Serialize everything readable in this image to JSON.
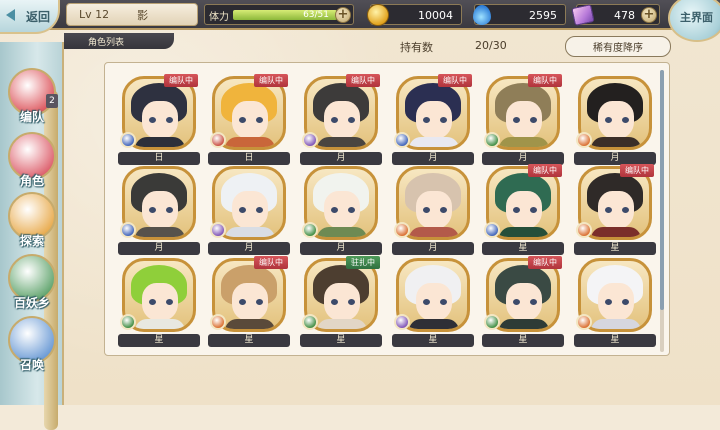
{
  "header": {
    "back_label": "返回",
    "level": "Lv 12",
    "player_name": "影",
    "stamina_label": "体力",
    "stamina_value": "63/51",
    "stamina_fraction": 1.0,
    "coins": "10004",
    "water": "2595",
    "gems": "478",
    "main_label": "主界面"
  },
  "subheader": {
    "list_tab": "角色列表",
    "owned_label": "持有数",
    "owned_count": "20/30",
    "sort_label": "稀有度降序"
  },
  "sidebar": {
    "items": [
      {
        "label": "编队",
        "icon": "team-icon",
        "badge": "2",
        "color": "#d9434b"
      },
      {
        "label": "角色",
        "icon": "character-icon",
        "color": "#d94e5c"
      },
      {
        "label": "探索",
        "icon": "explore-icon",
        "color": "#e6a23b"
      },
      {
        "label": "百妖乡",
        "icon": "village-icon",
        "color": "#4f9a5d"
      },
      {
        "label": "召唤",
        "icon": "summon-icon",
        "color": "#5a8fd0"
      }
    ]
  },
  "characters": [
    {
      "name": "日",
      "tag": "编队中",
      "hair": "#2e3140",
      "body": "#2c2f3a",
      "elem": "#3a5fb8"
    },
    {
      "name": "日",
      "tag": "编队中",
      "hair": "#f0b43c",
      "body": "#c9663a",
      "elem": "#c84a3e"
    },
    {
      "name": "月",
      "tag": "编队中",
      "hair": "#3d3b3a",
      "body": "#4a4540",
      "elem": "#7b4fb5"
    },
    {
      "name": "月",
      "tag": "编队中",
      "hair": "#2b2f52",
      "body": "#e8e8f0",
      "elem": "#3a5fb8"
    },
    {
      "name": "月",
      "tag": "编队中",
      "hair": "#8f7e58",
      "body": "#a0944a",
      "elem": "#3a8a3e"
    },
    {
      "name": "月",
      "tag": "",
      "hair": "#23201f",
      "body": "#3b2e28",
      "elem": "#d96a2a"
    },
    {
      "name": "月",
      "tag": "",
      "hair": "#3a3a38",
      "body": "#56524c",
      "elem": "#3a5fb8"
    },
    {
      "name": "月",
      "tag": "",
      "hair": "#eef1f4",
      "body": "#d9dde4",
      "elem": "#7b4fb5"
    },
    {
      "name": "月",
      "tag": "",
      "hair": "#f1f3ee",
      "body": "#6e8a53",
      "elem": "#3a8a3e"
    },
    {
      "name": "月",
      "tag": "",
      "hair": "#d7c3ae",
      "body": "#b35a4a",
      "elem": "#d96a2a"
    },
    {
      "name": "星",
      "tag": "编队中",
      "hair": "#2f6b52",
      "body": "#264f3a",
      "elem": "#3a5fb8"
    },
    {
      "name": "星",
      "tag": "编队中",
      "hair": "#2f2a28",
      "body": "#7a2e2a",
      "elem": "#d96a2a"
    },
    {
      "name": "星",
      "tag": "",
      "hair": "#8fcf3a",
      "body": "#e8e8e0",
      "elem": "#3a8a3e"
    },
    {
      "name": "星",
      "tag": "编队中",
      "hair": "#caa06a",
      "body": "#5a4a3a",
      "elem": "#d96a2a"
    },
    {
      "name": "星",
      "tag": "驻扎中",
      "hair": "#4d3e30",
      "body": "#e2d6c6",
      "elem": "#3a8a3e"
    },
    {
      "name": "星",
      "tag": "",
      "hair": "#f0f0f2",
      "body": "#2f2f36",
      "elem": "#7b4fb5"
    },
    {
      "name": "星",
      "tag": "编队中",
      "hair": "#3a4a44",
      "body": "#2e3b36",
      "elem": "#3a8a3e"
    },
    {
      "name": "星",
      "tag": "",
      "hair": "#f4f4f6",
      "body": "#d6d6de",
      "elem": "#d96a2a"
    }
  ]
}
